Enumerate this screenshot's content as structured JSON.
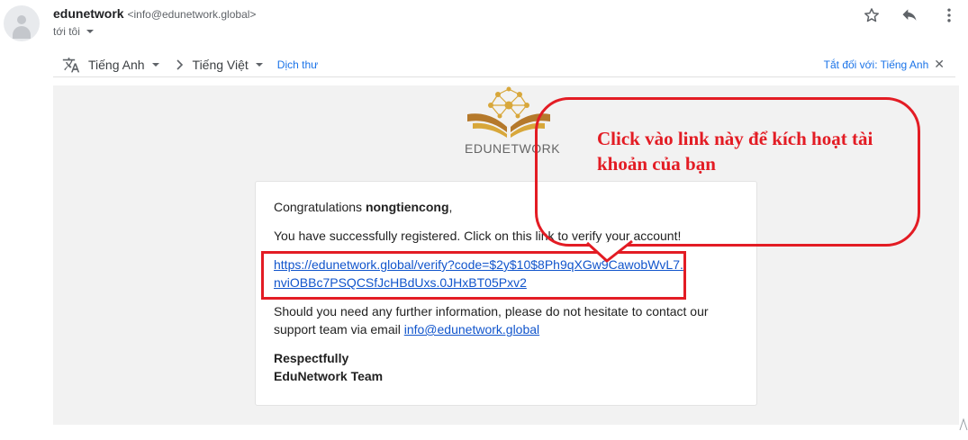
{
  "header": {
    "sender_name": "edunetwork",
    "sender_email": "<info@edunetwork.global>",
    "recipient": "tới tôi"
  },
  "actions": {
    "star": "star-icon",
    "reply": "reply-icon",
    "more": "more-vert-icon"
  },
  "translate_bar": {
    "from_lang": "Tiếng Anh",
    "to_lang": "Tiếng Việt",
    "translate_label": "Dịch thư",
    "turn_off": "Tắt đối với: Tiếng Anh"
  },
  "logo": {
    "text": "EDUNETWORK",
    "colors": {
      "gold": "#d8a73a",
      "brown": "#b5792b"
    }
  },
  "email": {
    "greeting": "Congratulations",
    "username": "nongtiencong",
    "greeting_end": ",",
    "line1": "You have successfully registered. Click on this link to verify your account!",
    "verify_link": "https://edunetwork.global/verify?code=$2y$10$8Ph9qXGw9CawobWvL7.nviOBBc7PSQCSfJcHBdUxs.0JHxBT05Pxv2",
    "line2_prefix": "Should you need any further information, please do not hesitate to contact our support team via email",
    "contact_email": "info@edunetwork.global",
    "signoff": "Respectfully",
    "team": "EduNetwork Team"
  },
  "annotation": {
    "text": "Click vào link này để kích hoạt tài khoản của bạn",
    "color": "#e31c24"
  }
}
